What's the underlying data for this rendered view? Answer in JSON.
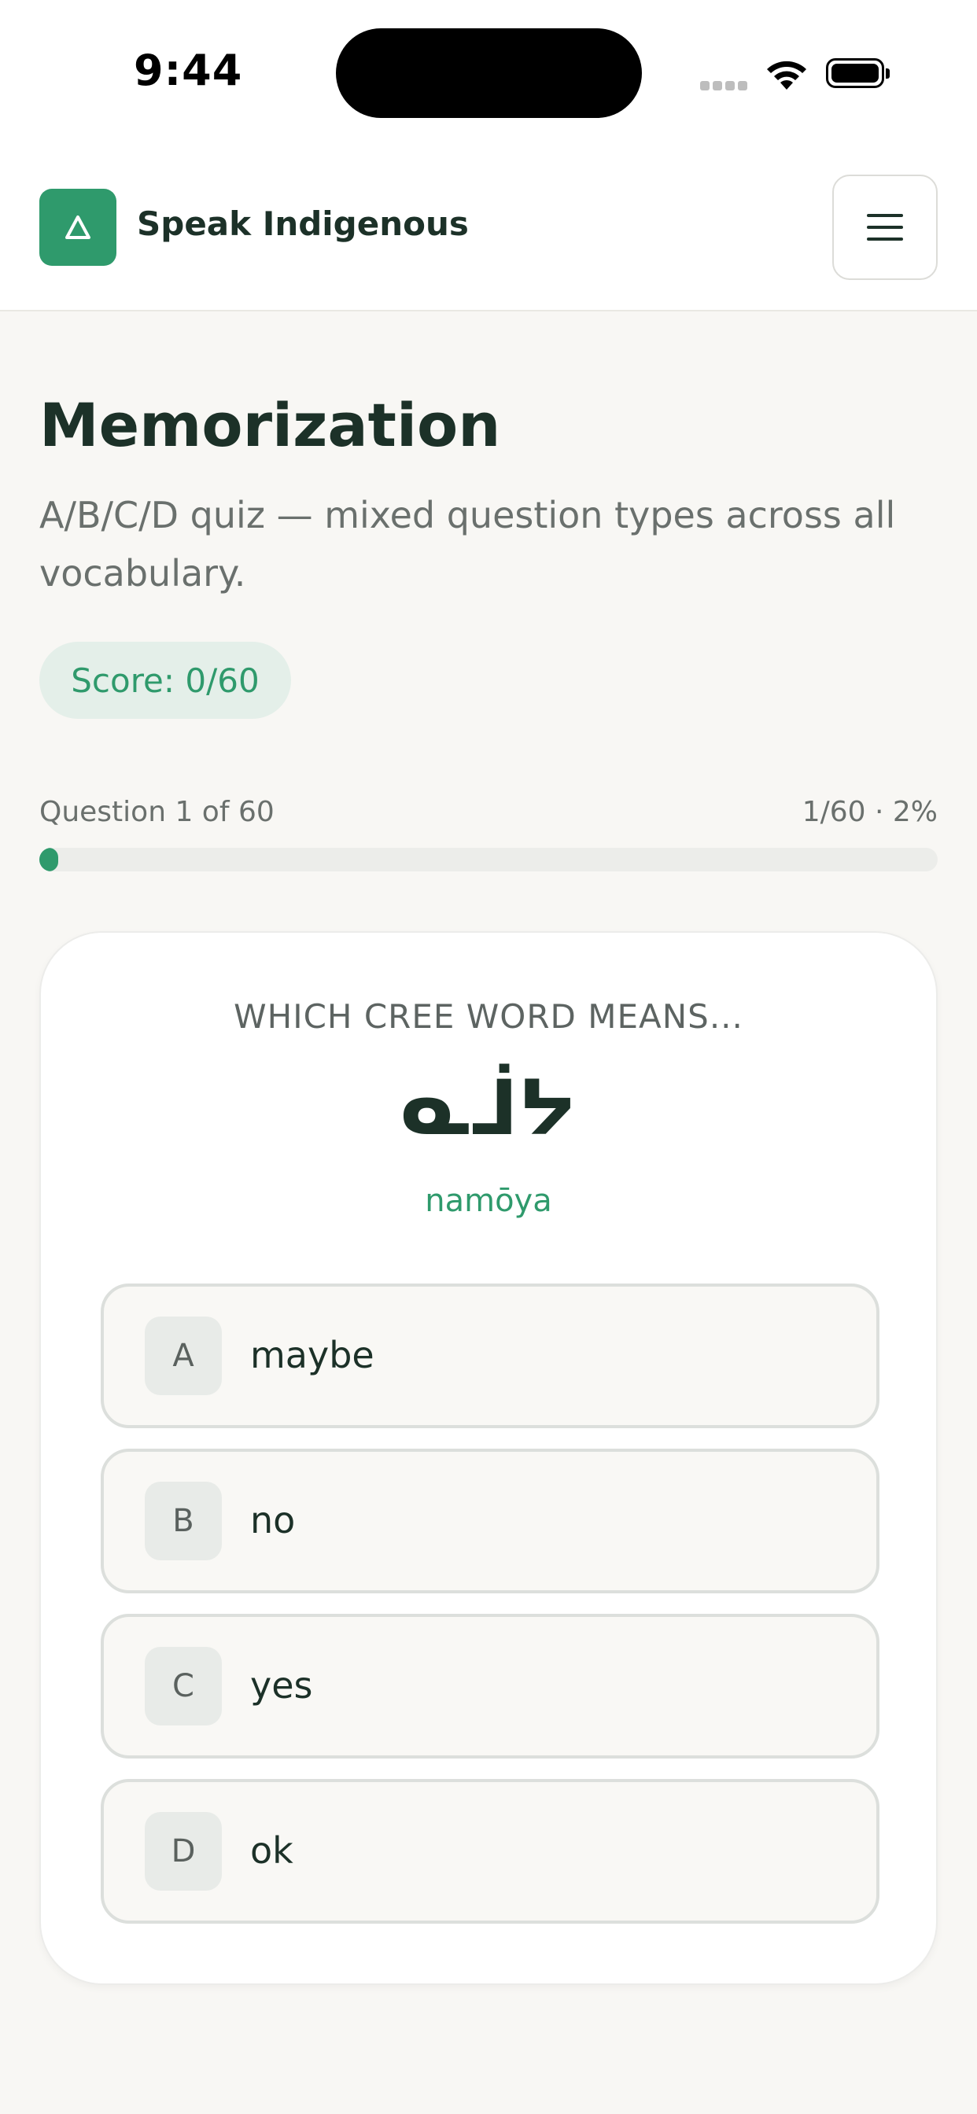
{
  "status_bar": {
    "time": "9:44"
  },
  "header": {
    "logo_glyph": "∆",
    "brand": "Speak Indigenous",
    "menu_icon": "hamburger-icon"
  },
  "page": {
    "title": "Memorization",
    "description": "A/B/C/D quiz — mixed question types across all vocabulary.",
    "score": "Score: 0/60"
  },
  "progress": {
    "label": "Question 1 of 60",
    "summary": "1/60 · 2%",
    "fraction": 0.02
  },
  "quiz": {
    "prompt": "WHICH CREE WORD MEANS...",
    "syllabics": "ᓇᒨᔭ",
    "romanized": "namōya",
    "options": [
      {
        "letter": "A",
        "text": "maybe"
      },
      {
        "letter": "B",
        "text": "no"
      },
      {
        "letter": "C",
        "text": "yes"
      },
      {
        "letter": "D",
        "text": "ok"
      }
    ]
  },
  "colors": {
    "accent": "#2f9a6c",
    "background": "#f8f7f4",
    "text": "#1c3128"
  }
}
